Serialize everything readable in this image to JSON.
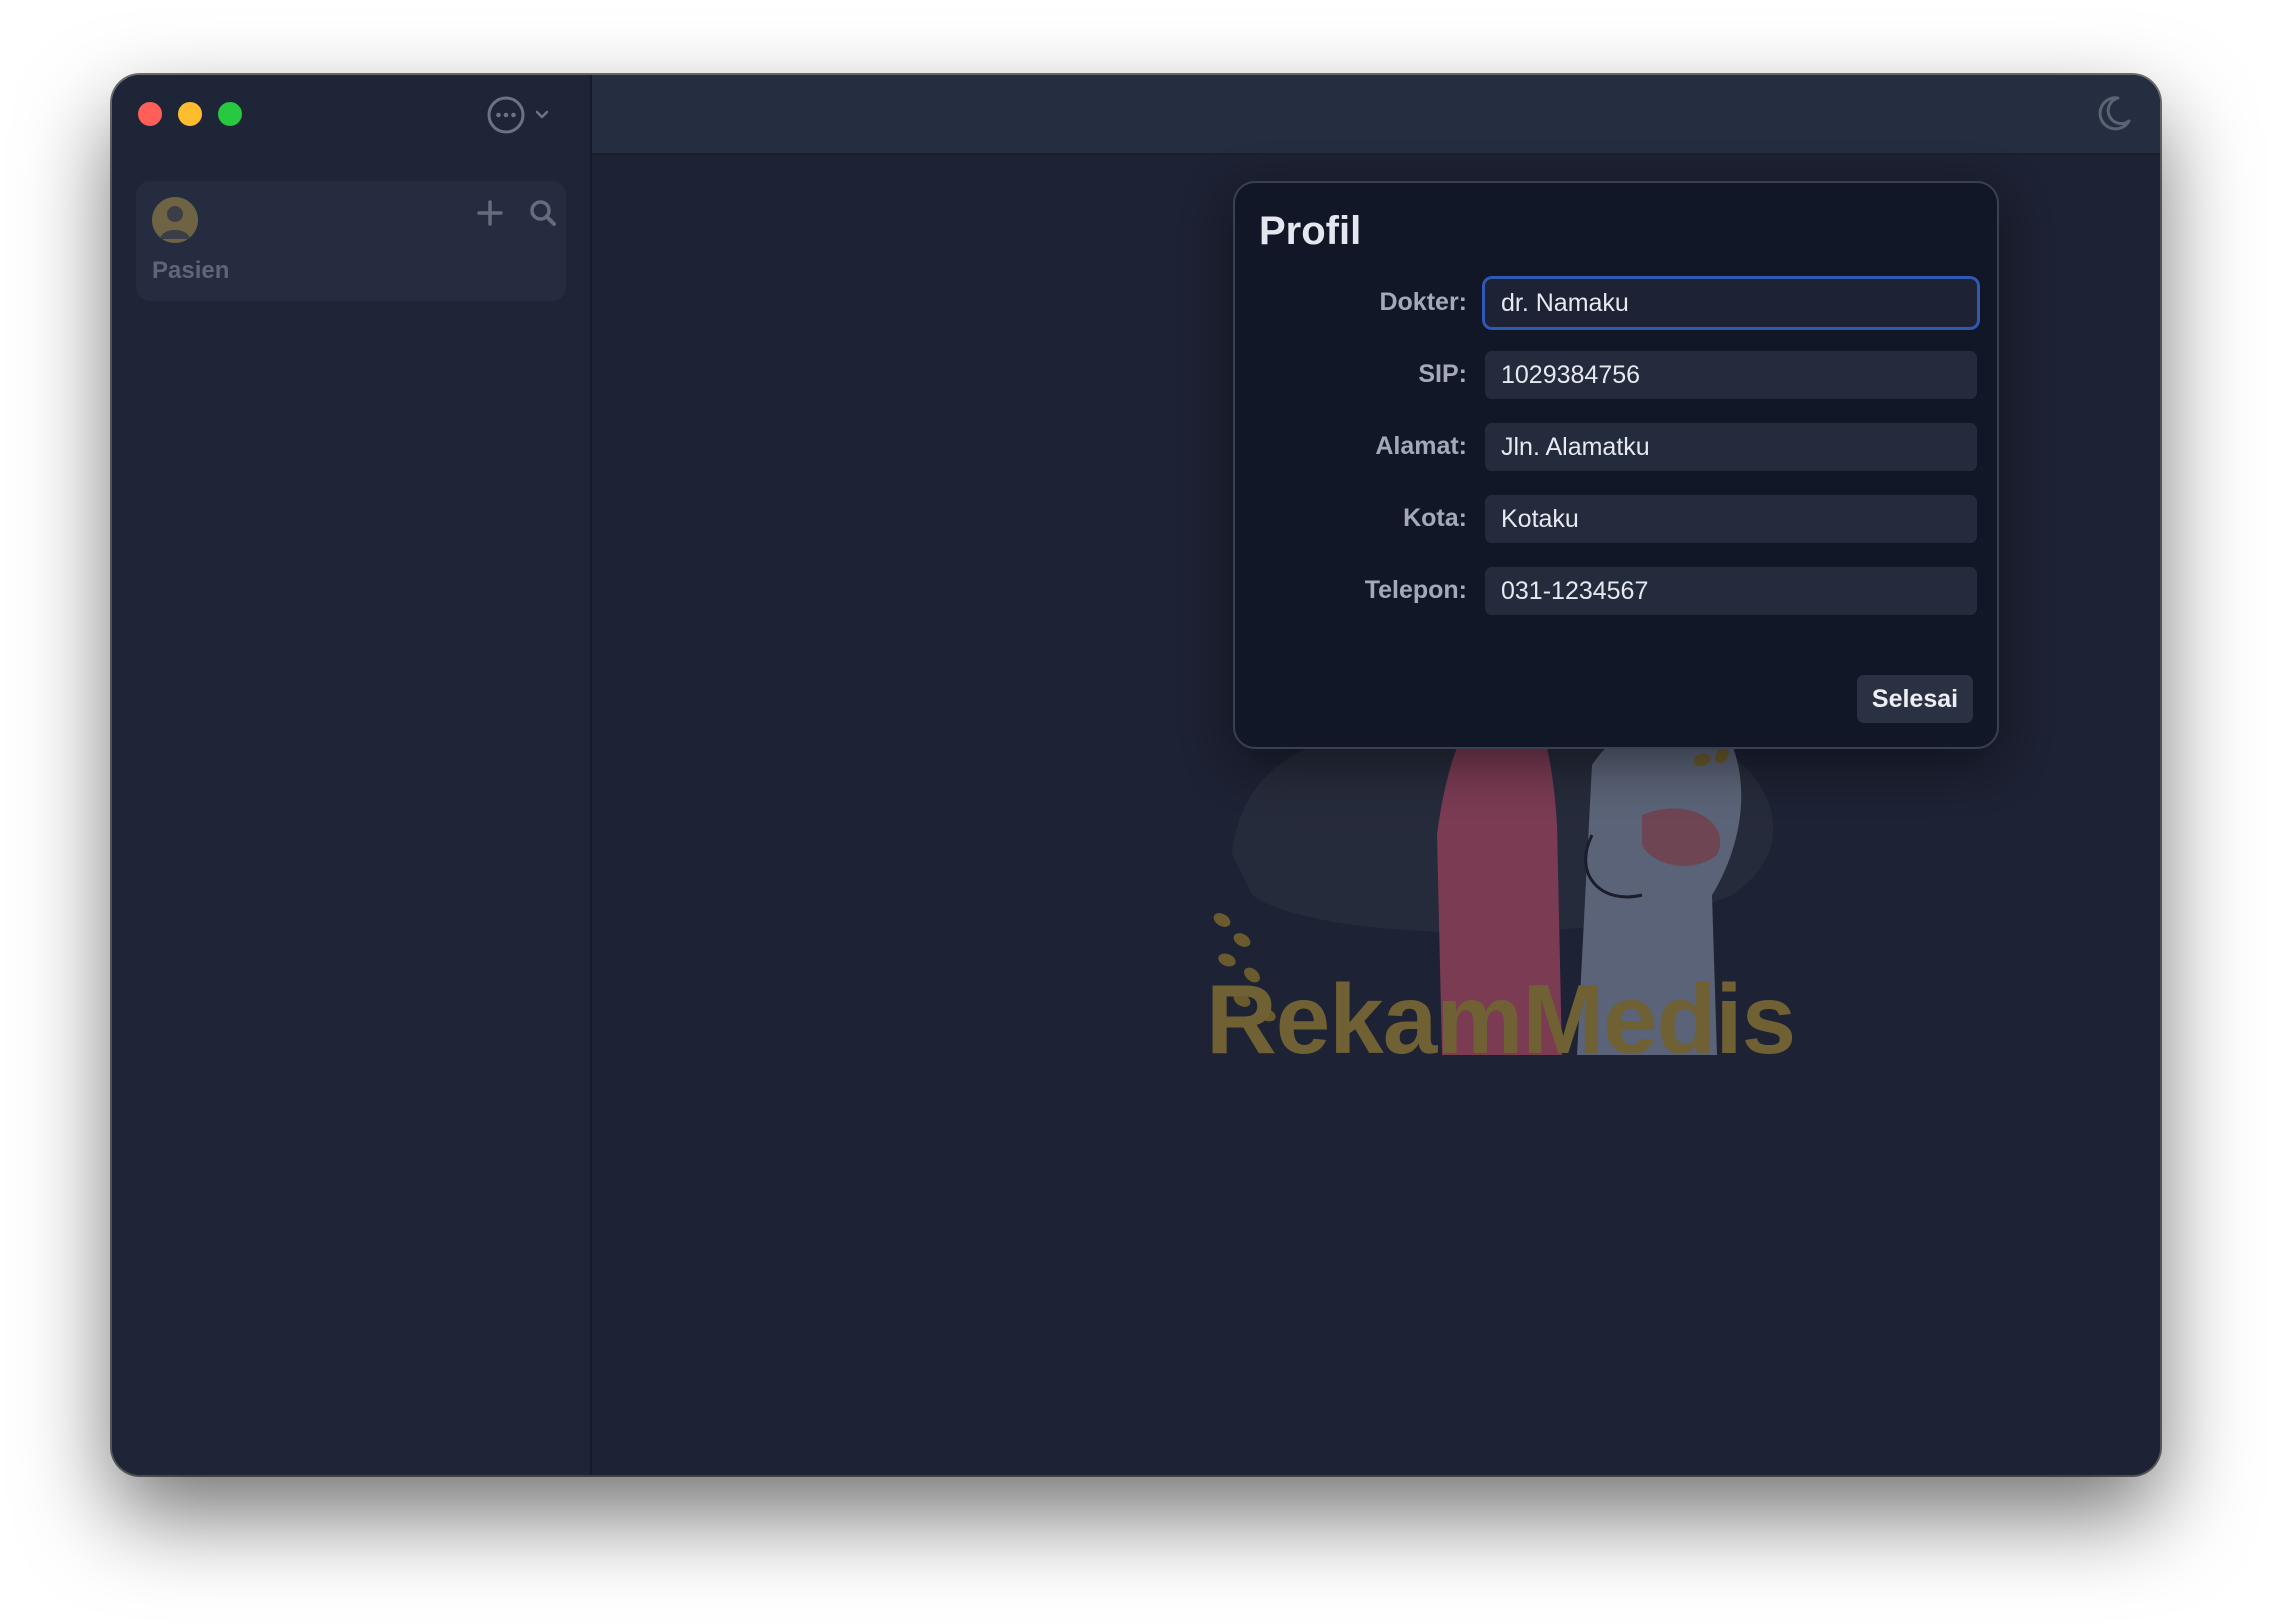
{
  "window": {
    "traffic_lights": {
      "close": "#ff5f57",
      "minimize": "#febc2e",
      "maximize": "#28c840"
    }
  },
  "sidebar": {
    "more_icon": "ellipsis-circle-icon",
    "patient_card": {
      "label": "Pasien",
      "add_icon": "plus-icon",
      "search_icon": "search-icon"
    }
  },
  "toolbar": {
    "theme_icon": "moon-icon"
  },
  "background": {
    "brand_text": "RekamMedis"
  },
  "profile_dialog": {
    "title": "Profil",
    "fields": [
      {
        "label": "Dokter:",
        "value": "dr. Namaku",
        "focused": true
      },
      {
        "label": "SIP:",
        "value": "1029384756"
      },
      {
        "label": "Alamat:",
        "value": "Jln. Alamatku"
      },
      {
        "label": "Kota:",
        "value": "Kotaku"
      },
      {
        "label": "Telepon:",
        "value": "031-1234567"
      }
    ],
    "done_label": "Selesai"
  },
  "colors": {
    "accent_focus": "#2f59b2",
    "brand": "#6f6134"
  }
}
